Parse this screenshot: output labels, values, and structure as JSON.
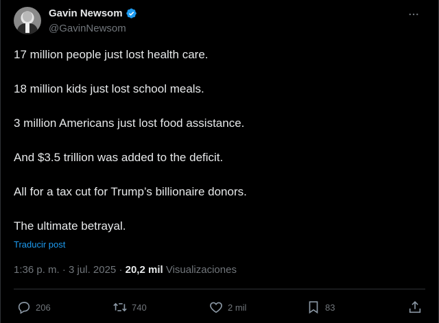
{
  "author": {
    "name": "Gavin Newsom",
    "handle": "@GavinNewsom",
    "verified_color": "#1d9bf0"
  },
  "more_icon": "more-horizontal-icon",
  "tweet": {
    "lines": [
      "17 million people just lost health care.",
      "18 million kids just lost school meals.",
      "3 million Americans just lost food assistance.",
      "And $3.5 trillion was added to the deficit.",
      "All for a tax cut for Trump’s billionaire donors.",
      "The ultimate betrayal."
    ],
    "translate_label": "Traducir post"
  },
  "meta": {
    "time": "1:36 p. m.",
    "sep1": " · ",
    "date": "3 jul. 2025",
    "sep2": " · ",
    "views_count": "20,2 mil",
    "views_label": "Visualizaciones"
  },
  "actions": {
    "replies": "206",
    "reposts": "740",
    "likes": "2 mil",
    "bookmarks": "83"
  },
  "colors": {
    "background": "#000000",
    "text": "#e7e9ea",
    "muted": "#71767b",
    "accent": "#1d9bf0",
    "divider": "#2f3336"
  }
}
